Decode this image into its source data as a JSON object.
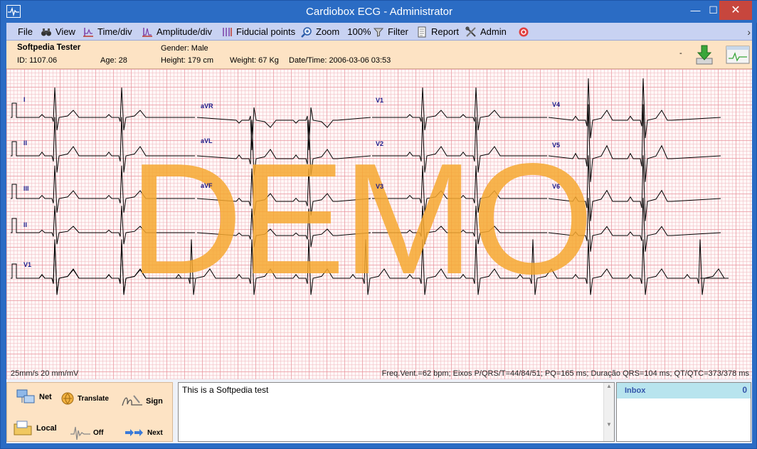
{
  "window": {
    "title": "Cardiobox ECG - Administrator",
    "min": "—",
    "max": "☐",
    "close": "✕"
  },
  "menu": [
    {
      "id": "file",
      "label": "File",
      "icon": ""
    },
    {
      "id": "view",
      "label": "View",
      "icon": "binoculars-icon"
    },
    {
      "id": "timediv",
      "label": "Time/div",
      "icon": "time-div-icon"
    },
    {
      "id": "ampdiv",
      "label": "Amplitude/div",
      "icon": "amplitude-div-icon"
    },
    {
      "id": "fiducial",
      "label": "Fiducial points",
      "icon": "fiducial-points-icon"
    },
    {
      "id": "zoom",
      "label": "Zoom",
      "icon": "zoom-icon",
      "value": "100%"
    },
    {
      "id": "filter",
      "label": "Filter",
      "icon": "filter-icon"
    },
    {
      "id": "report",
      "label": "Report",
      "icon": "report-icon"
    },
    {
      "id": "admin",
      "label": "Admin",
      "icon": "tools-icon"
    }
  ],
  "patient": {
    "name": "Softpedia Tester",
    "id": "ID: 1107.06",
    "age": "Age: 28",
    "gender": "Gender: Male",
    "height": "Height: 179 cm",
    "weight": "Weight: 67 Kg",
    "datetime": "Date/Time: 2006-03-06 03:53",
    "dash": "-"
  },
  "ecg": {
    "leads": [
      [
        "I",
        "II",
        "III",
        "II",
        "V1"
      ],
      [
        "aVR",
        "aVL",
        "aVF"
      ],
      [
        "V1",
        "V2",
        "V3"
      ],
      [
        "V4",
        "V5",
        "V6"
      ]
    ],
    "watermark": "DEMO",
    "scale": "25mm/s    20 mm/mV",
    "measurements": "Freq.Vent.=62 bpm;   Eixos P/QRS/T=44/84/51;   PQ=165 ms;   Duração QRS=104 ms;   QT/QTC=373/378 ms"
  },
  "actions": {
    "net": "Net",
    "translate": "Translate",
    "sign": "Sign",
    "local": "Local",
    "off": "Off",
    "next": "Next"
  },
  "notes": {
    "text": "This is a Softpedia test"
  },
  "inbox": {
    "label": "Inbox",
    "count": "0"
  },
  "colors": {
    "titlebar": "#2b6cc4",
    "menubar": "#c8d2f2",
    "header": "#fde3c4",
    "grid": "#e88c96",
    "watermark": "#f6a830",
    "trace": "#000000"
  }
}
